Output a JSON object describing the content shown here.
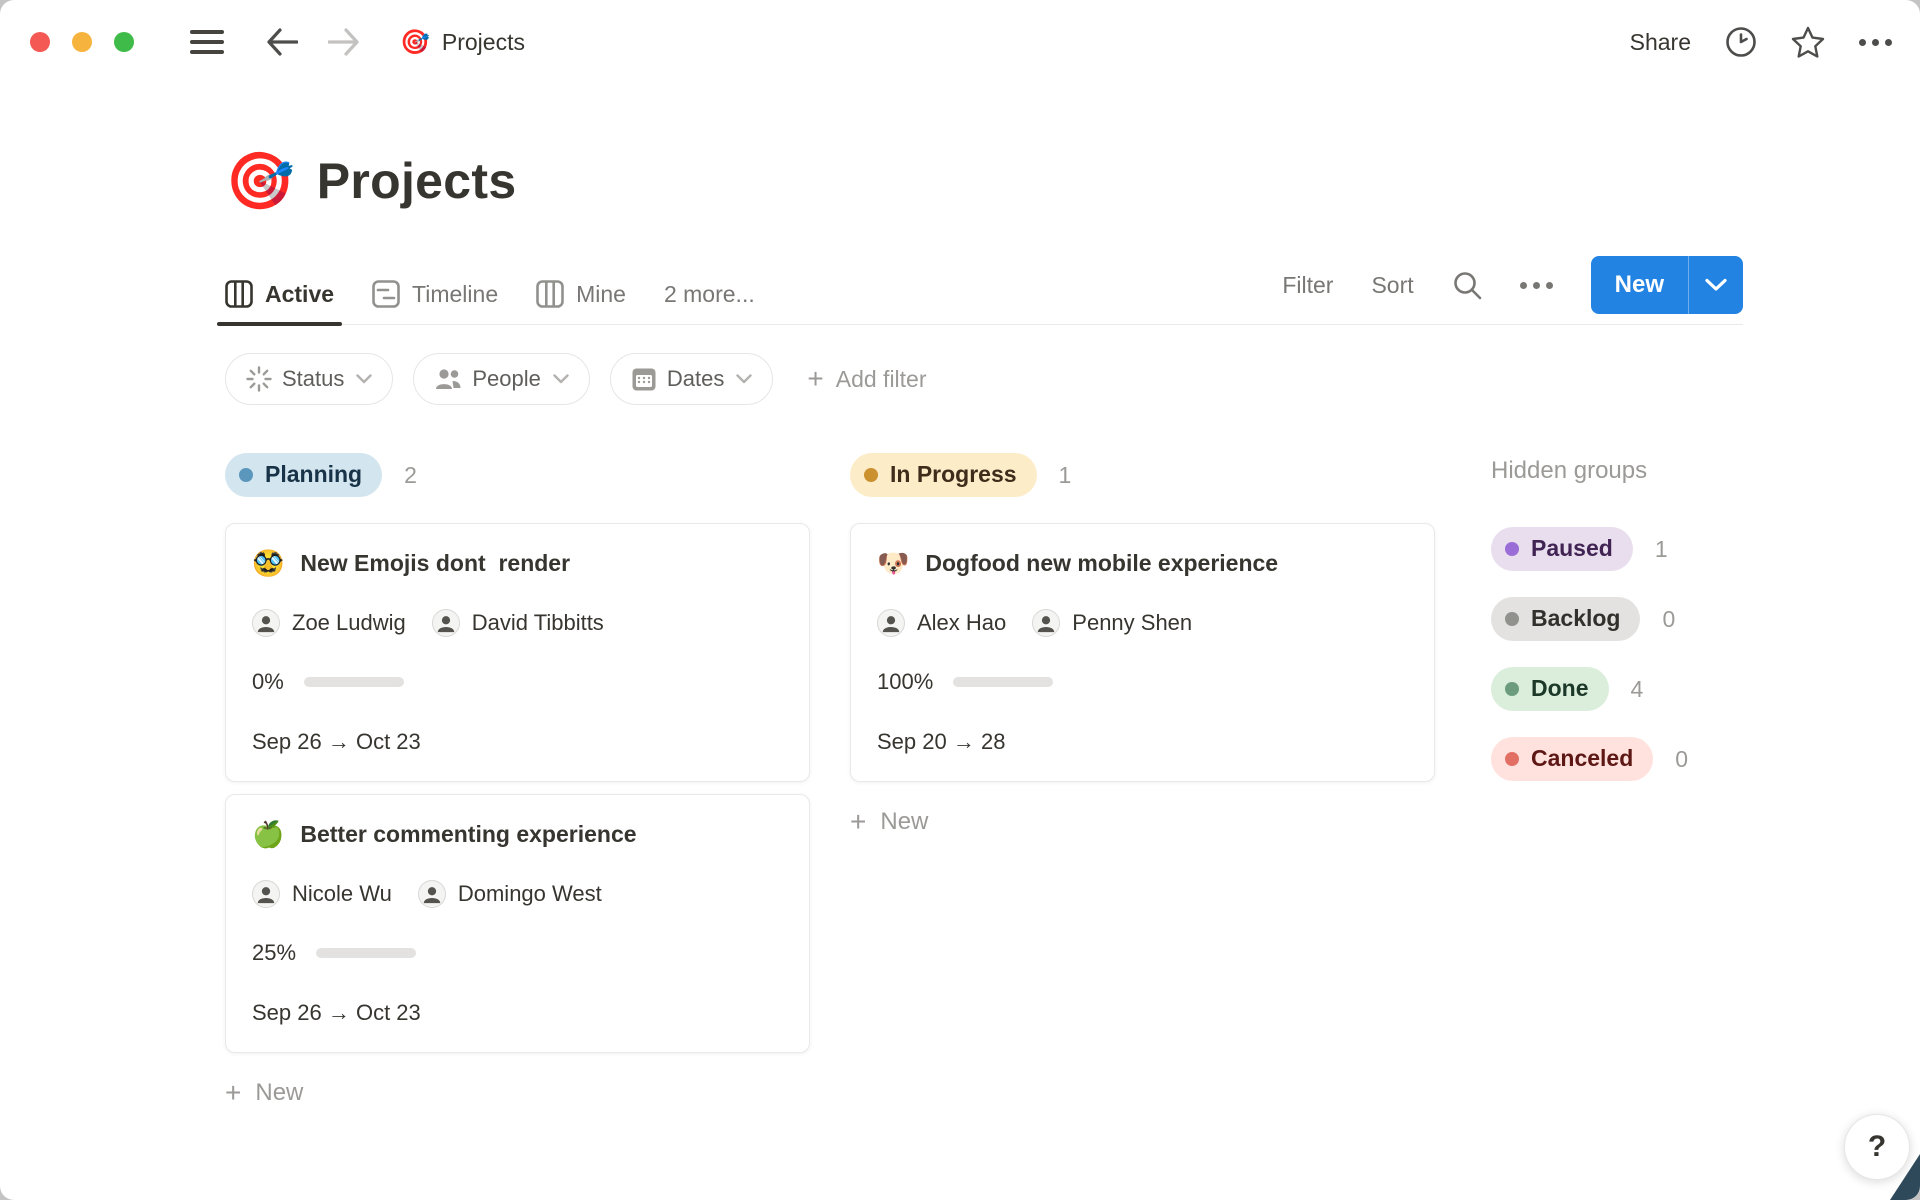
{
  "titlebar": {
    "document_icon": "🎯",
    "document_title": "Projects",
    "share_label": "Share"
  },
  "page": {
    "icon": "🎯",
    "title": "Projects"
  },
  "tabs": [
    {
      "label": "Active",
      "icon": "board-icon",
      "active": true
    },
    {
      "label": "Timeline",
      "icon": "timeline-icon",
      "active": false
    },
    {
      "label": "Mine",
      "icon": "board-icon",
      "active": false
    },
    {
      "label": "2 more...",
      "icon": null,
      "active": false
    }
  ],
  "view_controls": {
    "filter_label": "Filter",
    "sort_label": "Sort",
    "new_label": "New"
  },
  "filters": [
    {
      "label": "Status",
      "icon": "status-burst-icon"
    },
    {
      "label": "People",
      "icon": "people-icon"
    },
    {
      "label": "Dates",
      "icon": "calendar-icon"
    }
  ],
  "add_filter_label": "Add filter",
  "colors": {
    "accent_blue": "#2383e2",
    "progress_green": "#6b9e78",
    "progress_track": "#e3e2e0"
  },
  "board": {
    "groups": [
      {
        "name": "Planning",
        "count": "2",
        "colors": {
          "bg": "#d3e5ef",
          "text": "#183347",
          "dot": "#5b97bd"
        },
        "new_label": "New",
        "cards": [
          {
            "emoji": "🥸",
            "title": "New Emojis dont  render",
            "people": [
              "Zoe Ludwig",
              "David Tibbitts"
            ],
            "progress_label": "0%",
            "progress_value": 0,
            "dates": "Sep 26 → Oct 23"
          },
          {
            "emoji": "🍏",
            "title": "Better commenting experience",
            "people": [
              "Nicole Wu",
              "Domingo West"
            ],
            "progress_label": "25%",
            "progress_value": 25,
            "dates": "Sep 26 → Oct 23"
          }
        ]
      },
      {
        "name": "In Progress",
        "count": "1",
        "colors": {
          "bg": "#fdecc8",
          "text": "#402c1b",
          "dot": "#cb912f"
        },
        "new_label": "New",
        "cards": [
          {
            "emoji": "🐶",
            "title": "Dogfood new mobile experience",
            "people": [
              "Alex Hao",
              "Penny Shen"
            ],
            "progress_label": "100%",
            "progress_value": 100,
            "dates": "Sep 20 → 28"
          }
        ]
      }
    ],
    "hidden": {
      "title": "Hidden groups",
      "groups": [
        {
          "name": "Paused",
          "count": "1",
          "colors": {
            "bg": "#e8deee",
            "text": "#412454",
            "dot": "#9a6dd7"
          }
        },
        {
          "name": "Backlog",
          "count": "0",
          "colors": {
            "bg": "#e3e2e0",
            "text": "#32302c",
            "dot": "#91918e"
          }
        },
        {
          "name": "Done",
          "count": "4",
          "colors": {
            "bg": "#dbeddb",
            "text": "#1c3829",
            "dot": "#6c9b7d"
          }
        },
        {
          "name": "Canceled",
          "count": "0",
          "colors": {
            "bg": "#ffe2dd",
            "text": "#5d1715",
            "dot": "#e16f64"
          }
        }
      ]
    }
  },
  "help_label": "?"
}
